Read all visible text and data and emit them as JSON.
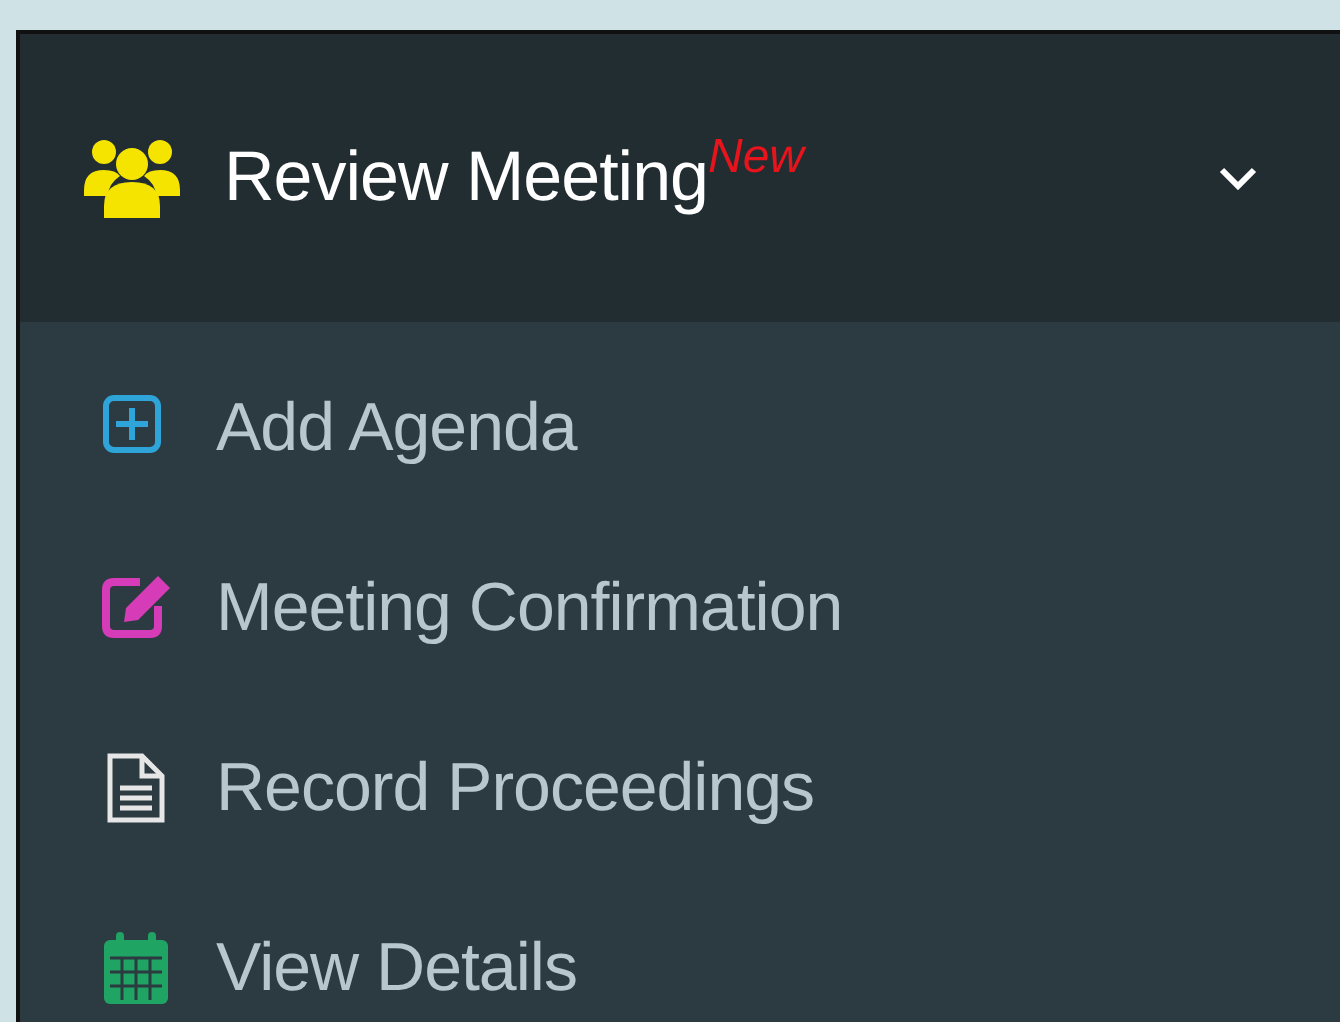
{
  "menu": {
    "title": "Review Meeting",
    "badge": "New",
    "expanded": true,
    "items": [
      {
        "label": "Add Agenda",
        "kind": "plus",
        "color": "#2fa4d9"
      },
      {
        "label": "Meeting Confirmation",
        "kind": "edit",
        "color": "#d63bb8"
      },
      {
        "label": "Record Proceedings",
        "kind": "document",
        "color": "#e6e6e6"
      },
      {
        "label": "View Details",
        "kind": "calendar",
        "color": "#1fa463"
      }
    ]
  }
}
